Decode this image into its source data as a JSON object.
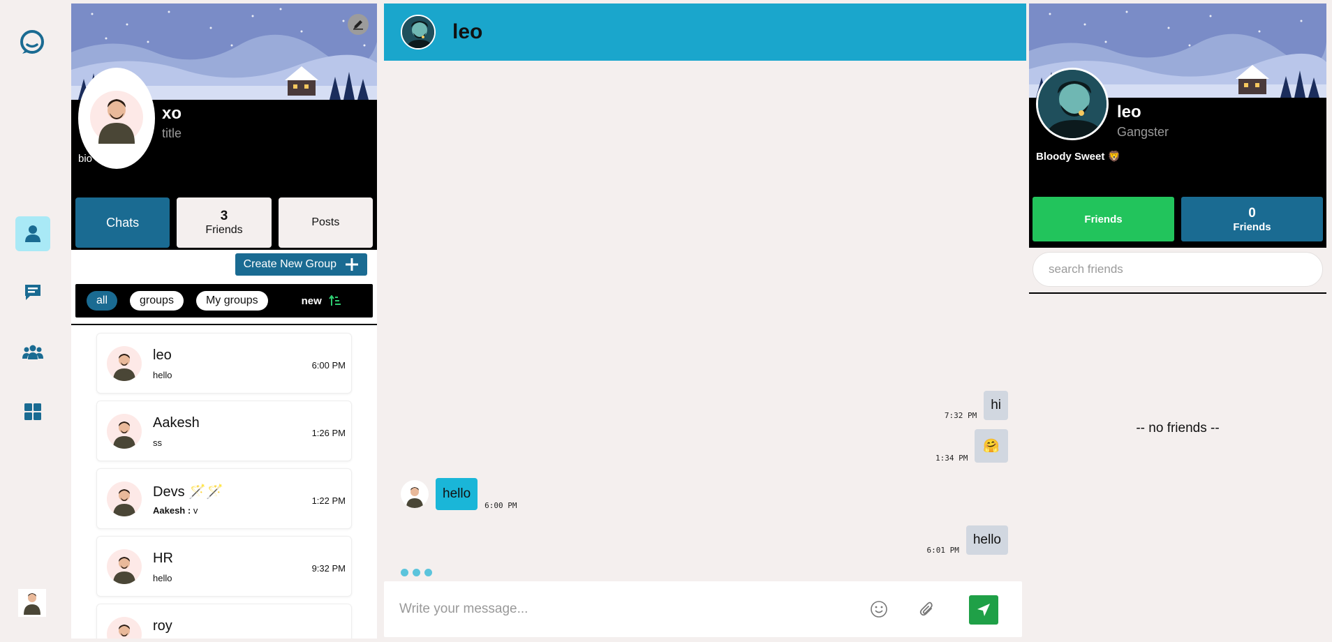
{
  "app": {
    "logo_icon": "chat-bubble-logo-icon",
    "accent": "#1a6b92",
    "header_color": "#1aa6cc"
  },
  "rail": {
    "items": [
      {
        "icon": "user-icon",
        "active": true
      },
      {
        "icon": "message-icon",
        "active": false
      },
      {
        "icon": "group-icon",
        "active": false
      },
      {
        "icon": "dashboard-icon",
        "active": false
      }
    ]
  },
  "profile": {
    "name": "xo",
    "title": "title",
    "bio": "bio"
  },
  "tabs": {
    "chats": "Chats",
    "friends_count": "3",
    "friends_label": "Friends",
    "posts": "Posts"
  },
  "create_group": "Create New Group",
  "filters": {
    "all": "all",
    "groups": "groups",
    "my_groups": "My groups",
    "sort": "new"
  },
  "chats": [
    {
      "name": "leo",
      "last_sender": "",
      "last": "hello",
      "time": "6:00 PM"
    },
    {
      "name": "Aakesh",
      "last_sender": "",
      "last": "ss",
      "time": "1:26 PM"
    },
    {
      "name": "Devs 🪄🪄",
      "last_sender": "Aakesh : ",
      "last": "v",
      "time": "1:22 PM"
    },
    {
      "name": "HR",
      "last_sender": "",
      "last": "hello",
      "time": "9:32 PM"
    },
    {
      "name": "roy",
      "last_sender": "",
      "last": "",
      "time": ""
    }
  ],
  "conversation": {
    "name": "leo",
    "messages": [
      {
        "dir": "out",
        "text": "hi",
        "time": "7:32 PM"
      },
      {
        "dir": "out",
        "text": "🤗",
        "time": "1:34 PM"
      },
      {
        "dir": "in",
        "text": "hello",
        "time": "6:00 PM"
      },
      {
        "dir": "out",
        "text": "hello",
        "time": "6:01 PM"
      }
    ],
    "composer_placeholder": "Write your message..."
  },
  "friend_profile": {
    "name": "leo",
    "title": "Gangster",
    "bio": "Bloody Sweet 🦁",
    "friends_button": "Friends",
    "friends_count": "0",
    "friends_label": "Friends",
    "search_placeholder": "search friends",
    "empty": "-- no friends --"
  }
}
